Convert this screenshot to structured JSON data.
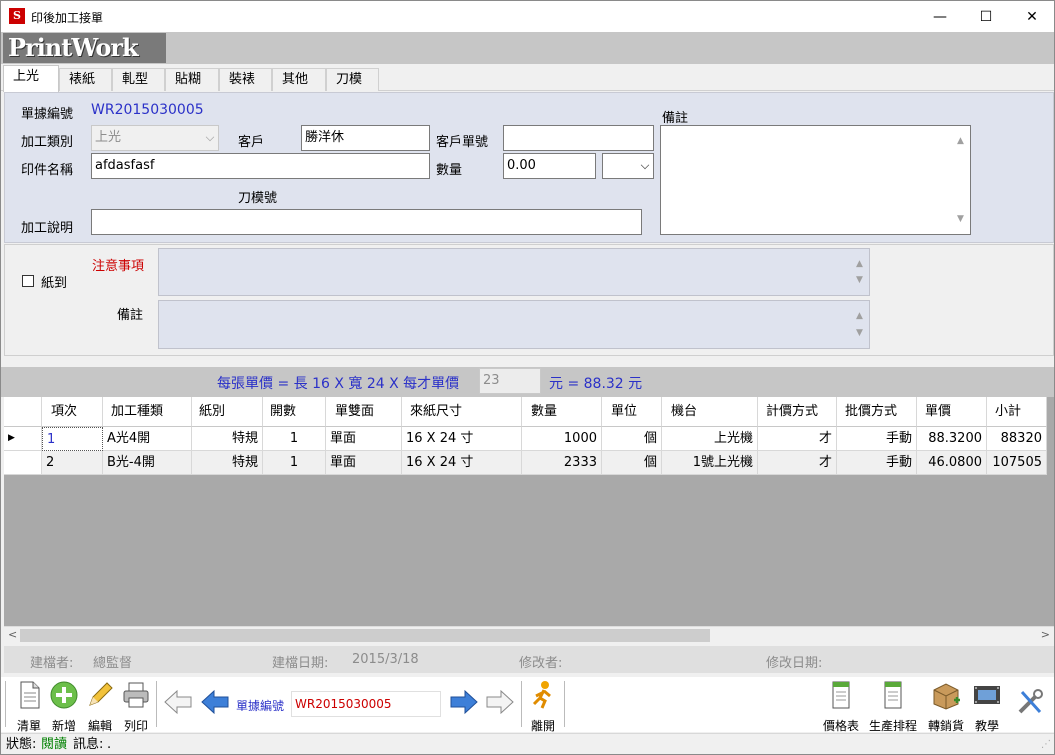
{
  "window": {
    "title": "印後加工接單",
    "minimize": "—",
    "maximize": "☐",
    "close": "✕"
  },
  "logo": "PrintWork",
  "tabs": [
    "上光",
    "裱紙",
    "軋型",
    "貼糊",
    "裝裱",
    "其他",
    "刀模"
  ],
  "form": {
    "doc_no_label": "單據編號",
    "doc_no": "WR2015030005",
    "process_type_label": "加工類別",
    "process_type": "上光",
    "customer_label": "客戶",
    "customer": "勝洋休",
    "customer_order_label": "客戶單號",
    "customer_order": "",
    "print_name_label": "印件名稱",
    "print_name": "afdasfasf",
    "quantity_label": "數量",
    "quantity": "0.00",
    "unit": "",
    "die_no_label": "刀模號",
    "description_label": "加工說明",
    "description": "",
    "remark_label": "備註",
    "remark": ""
  },
  "notes": {
    "paper_label": "紙到",
    "attention_label": "注意事項",
    "remark_label": "備註"
  },
  "formula": {
    "text": "每張單價 = 長 16 X  寬 24 X 每才單價",
    "unit_price": "23",
    "result": "元 = 88.32 元"
  },
  "grid": {
    "columns": [
      "項次",
      "加工種類",
      "紙別",
      "開數",
      "單雙面",
      "來紙尺寸",
      "數量",
      "單位",
      "機台",
      "計價方式",
      "批價方式",
      "單價",
      "小計"
    ],
    "rows": [
      {
        "marker": "▶",
        "cells": [
          "1",
          "A光4開",
          "特規",
          "1",
          "單面",
          "16 X 24 寸",
          "1000",
          "個",
          "上光機",
          "才",
          "手動",
          "88.3200",
          "88320"
        ]
      },
      {
        "marker": "",
        "cells": [
          "2",
          "B光-4開",
          "特規",
          "1",
          "單面",
          "16 X 24 寸",
          "2333",
          "個",
          "1號上光機",
          "才",
          "手動",
          "46.0800",
          "107505"
        ]
      }
    ]
  },
  "info": {
    "creator_label": "建檔者:",
    "creator": "總監督",
    "created_label": "建檔日期:",
    "created": "2015/3/18",
    "modifier_label": "修改者:",
    "modified_label": "修改日期:"
  },
  "toolbar": {
    "list": "清單",
    "add": "新增",
    "edit": "編輯",
    "print": "列印",
    "doc_no_label": "單據編號",
    "doc_no": "WR2015030005",
    "exit": "離開",
    "price_table": "價格表",
    "schedule": "生產排程",
    "to_sales": "轉銷貨",
    "tutorial": "教學"
  },
  "status": {
    "label": "狀態:",
    "state": "閱讀",
    "msg_label": "訊息:",
    "msg": "."
  },
  "colors": {
    "label_blue": "#2b31c8",
    "warn_red": "#cc0000",
    "panel": "#dfe3ee",
    "state_green": "#008000"
  }
}
